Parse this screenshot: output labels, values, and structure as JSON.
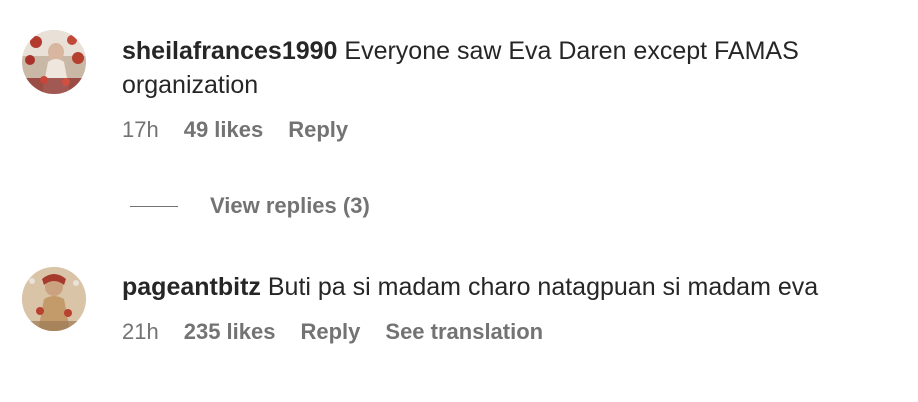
{
  "comments": [
    {
      "username": "sheilafrances1990",
      "text": "Everyone saw Eva Daren except FAMAS organization",
      "time": "17h",
      "likes": "49 likes",
      "reply_label": "Reply",
      "avatar_icon": "user-avatar-photo"
    },
    {
      "username": "pageantbitz",
      "text": "Buti pa si madam charo natagpuan si madam eva",
      "time": "21h",
      "likes": "235 likes",
      "reply_label": "Reply",
      "translation_label": "See translation",
      "avatar_icon": "user-avatar-photo"
    }
  ],
  "view_replies": {
    "label": "View replies (3)"
  },
  "colors": {
    "text": "#262626",
    "secondary": "#737373",
    "background": "#ffffff"
  }
}
